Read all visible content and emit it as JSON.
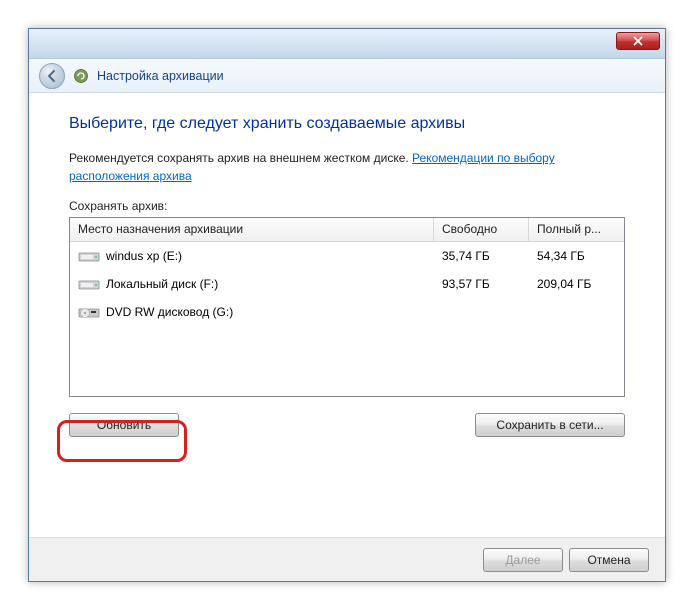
{
  "window": {
    "title": "Настройка архивации"
  },
  "heading": "Выберите, где следует хранить создаваемые архивы",
  "recommendation": {
    "text": "Рекомендуется сохранять архив на внешнем жестком диске. ",
    "link": "Рекомендации по выбору расположения архива"
  },
  "save_label": "Сохранять архив:",
  "columns": {
    "destination": "Место назначения архивации",
    "free": "Свободно",
    "total": "Полный р..."
  },
  "drives": [
    {
      "icon": "hdd",
      "name": "windus xp (E:)",
      "free": "35,74 ГБ",
      "total": "54,34 ГБ"
    },
    {
      "icon": "hdd",
      "name": "Локальный диск (F:)",
      "free": "93,57 ГБ",
      "total": "209,04 ГБ"
    },
    {
      "icon": "dvd",
      "name": "DVD RW дисковод (G:)",
      "free": "",
      "total": ""
    }
  ],
  "buttons": {
    "refresh": "Обновить",
    "save_network": "Сохранить в сети...",
    "next": "Далее",
    "cancel": "Отмена"
  }
}
